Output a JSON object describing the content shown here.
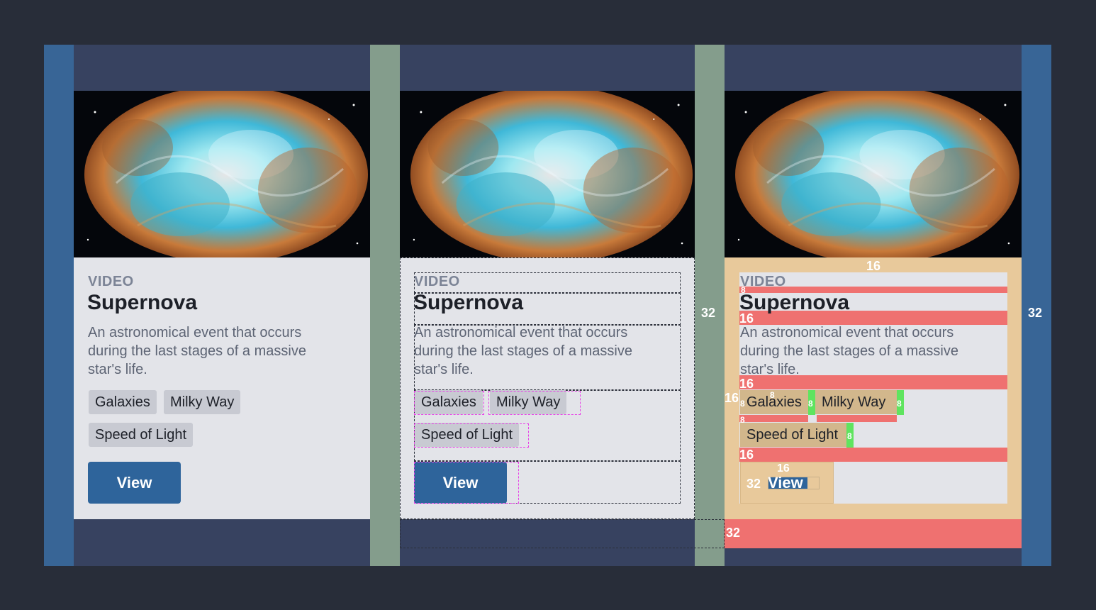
{
  "card": {
    "eyebrow": "VIDEO",
    "title": "Supernova",
    "description": "An astronomical event that occurs during the last stages of a massive star's life.",
    "tags": [
      "Galaxies",
      "Milky Way",
      "Speed of Light"
    ],
    "button_label": "View",
    "image_icon": "crab-nebula-image"
  },
  "spacing_labels": {
    "outer_right": "32",
    "card_padding": "16",
    "gap_8": "8",
    "gap_16": "16",
    "button_padding_x": "32",
    "button_padding_y": "16",
    "bottom_padding": "32"
  },
  "colors": {
    "background": "#282d39",
    "frame": "#374260",
    "side_panel": "#386596",
    "gutter": "#849d8c",
    "card": "#e3e4e9",
    "button": "#2e649b",
    "padding_overlay": "#e8c99b",
    "margin_overlay": "#ef7170",
    "gap_overlay": "#5fe45f",
    "outline_dashed": "#e83ee8"
  }
}
